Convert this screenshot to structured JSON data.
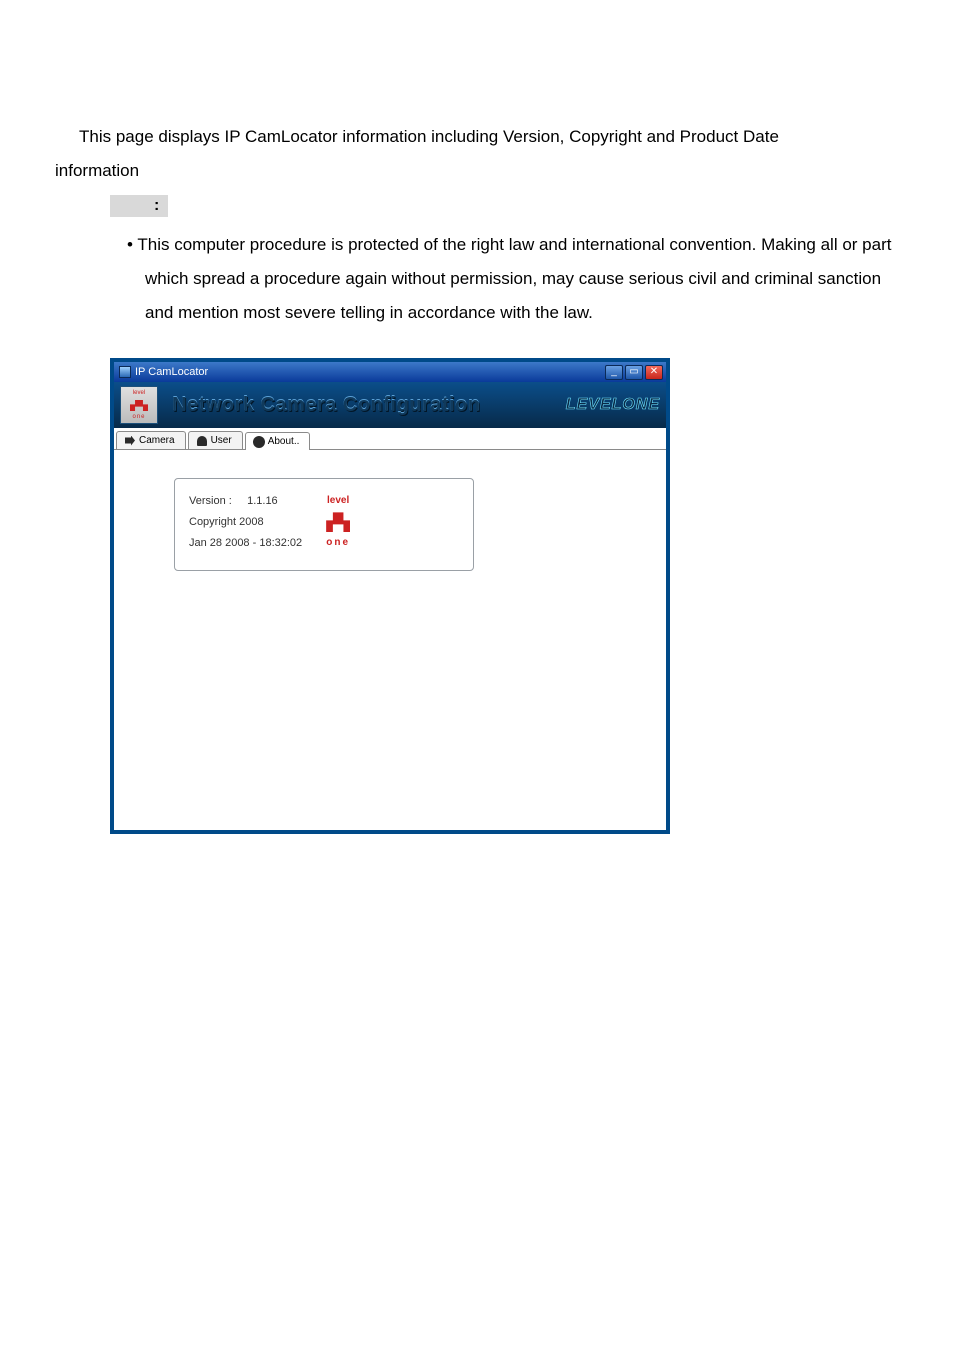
{
  "intro_line1": "This page displays IP CamLocator information including Version, Copyright and Product Date",
  "intro_line2": "information",
  "note_heading": ":",
  "bullet_line1": "This computer procedure is protected of the right law and international convention. Making all or part",
  "bullet_line2": "which spread a procedure again without permission, may cause serious civil and criminal sanction",
  "bullet_line3": "and mention most severe telling in accordance with the law.",
  "window": {
    "title": "IP CamLocator",
    "banner_title": "Network Camera Configuration",
    "brand": "LEVELONE",
    "tabs": {
      "camera": "Camera",
      "user": "User",
      "about": "About..",
      "active": "about"
    },
    "info": {
      "version_label": "Version :",
      "version_value": "1.1.16",
      "copyright": "Copyright 2008",
      "datetime": "Jan 28 2008 - 18:32:02",
      "logo_top": "level",
      "logo_bottom": "one"
    }
  }
}
